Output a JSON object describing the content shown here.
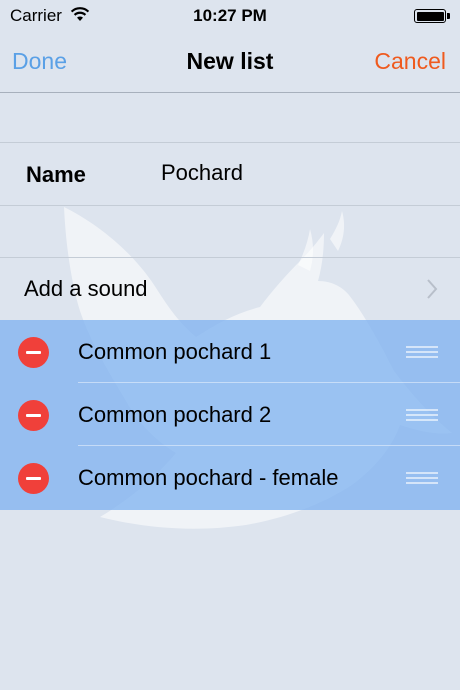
{
  "status_bar": {
    "carrier": "Carrier",
    "time": "10:27 PM",
    "icons": [
      "wifi-icon",
      "battery-icon"
    ]
  },
  "nav": {
    "done_label": "Done",
    "title": "New list",
    "cancel_label": "Cancel"
  },
  "form": {
    "name_label": "Name",
    "name_value": "Pochard"
  },
  "add_sound": {
    "label": "Add a sound"
  },
  "sounds": [
    {
      "label": "Common pochard 1"
    },
    {
      "label": "Common pochard 2"
    },
    {
      "label": "Common pochard - female"
    }
  ],
  "colors": {
    "done": "#5aa0e6",
    "cancel": "#ef5a1e",
    "delete": "#f0403a",
    "sounds_background": "#7db1f0",
    "page_background": "#dde4ee"
  }
}
